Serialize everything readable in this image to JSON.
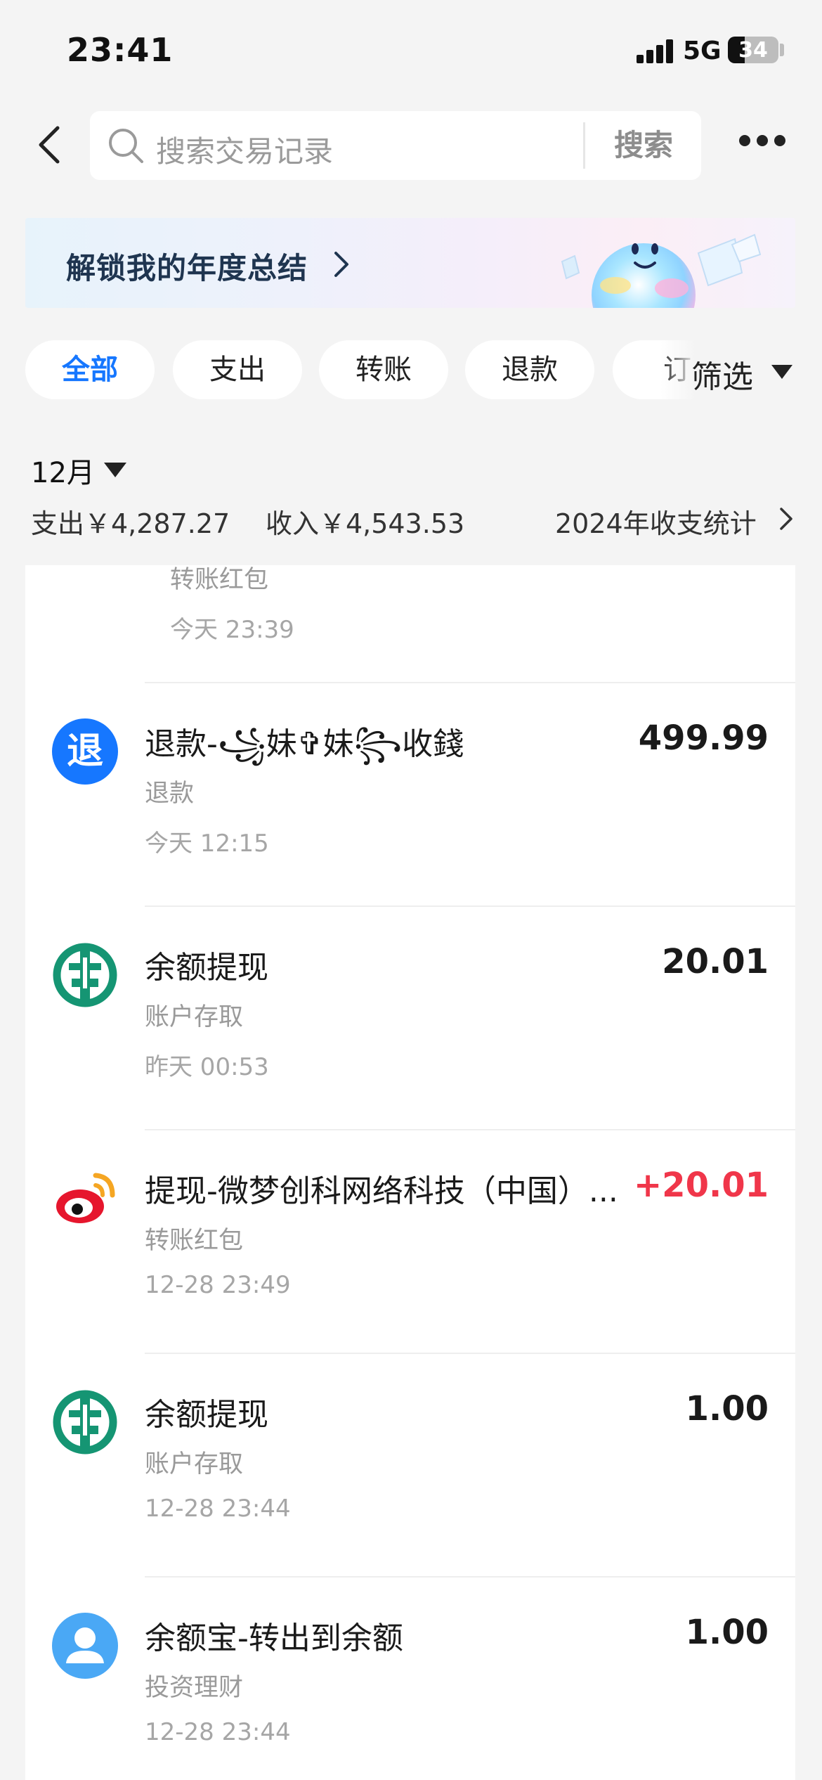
{
  "status_bar": {
    "time": "23:41",
    "network": "5G",
    "battery": "34",
    "battery_level": 0.34
  },
  "header": {
    "search_placeholder": "搜索交易记录",
    "search_button": "搜索"
  },
  "banner": {
    "text": "解锁我的年度总结"
  },
  "filters": {
    "chips": [
      "全部",
      "支出",
      "转账",
      "退款",
      "订"
    ],
    "active": "全部",
    "filter_label": "筛选"
  },
  "summary": {
    "month": "12月",
    "expense": "支出￥4,287.27",
    "income": "收入￥4,543.53",
    "annual_stats": "2024年收支统计"
  },
  "partial_item": {
    "category": "转账红包",
    "time": "今天 23:39"
  },
  "transactions": [
    {
      "icon": "refund-icon",
      "icon_glyph": "退",
      "title": "退款-꧁妹✞妹꧂收錢",
      "amount": "499.99",
      "category": "退款",
      "time": "今天 12:15"
    },
    {
      "icon": "abc-bank-icon",
      "title": "余额提现",
      "amount": "20.01",
      "category": "账户存取",
      "time": "昨天 00:53"
    },
    {
      "icon": "weibo-icon",
      "title": "提现-微梦创科网络科技（中国）...",
      "amount": "+20.01",
      "category": "转账红包",
      "time": "12-28 23:49"
    },
    {
      "icon": "abc-bank-icon",
      "title": "余额提现",
      "amount": "1.00",
      "category": "账户存取",
      "time": "12-28 23:44"
    },
    {
      "icon": "user-avatar-icon",
      "title": "余额宝-转出到余额",
      "amount": "1.00",
      "category": "投资理财",
      "time": "12-28 23:44"
    }
  ],
  "colors": {
    "accent": "#1677ff",
    "income": "#f0364a",
    "bank_green": "#159573",
    "background": "#f4f4f4"
  }
}
